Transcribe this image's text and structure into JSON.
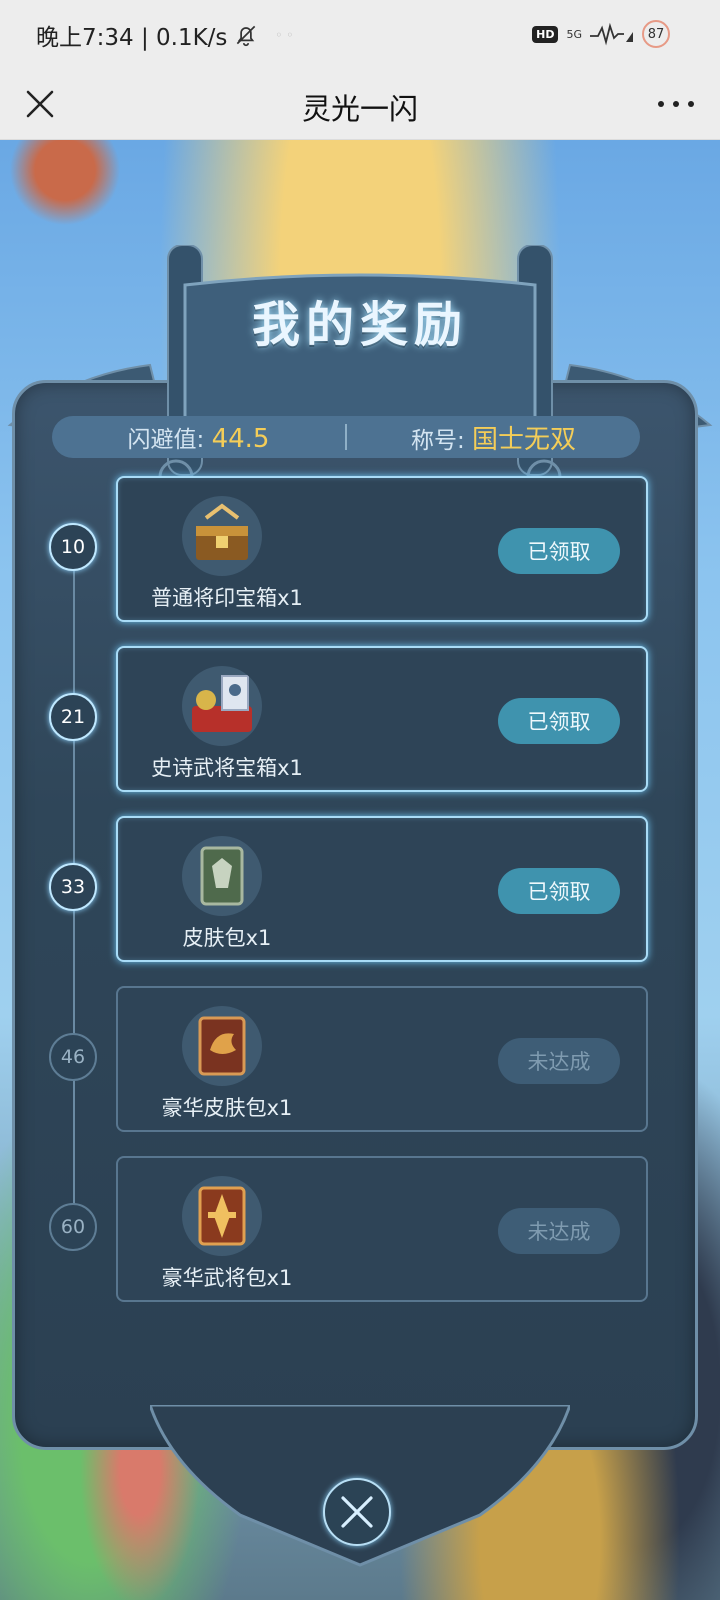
{
  "status_bar": {
    "time_speed": "晚上7:34 | 0.1K/s",
    "hd": "HD",
    "network": "5G",
    "battery": "87"
  },
  "titlebar": {
    "title": "灵光一闪"
  },
  "panel": {
    "title": "我的奖励",
    "dodge_label": "闪避值:",
    "dodge_value": "44.5",
    "rank_label": "称号:",
    "rank_value": "国士无双"
  },
  "rewards": [
    {
      "level": "10",
      "name": "普通将印宝箱x1",
      "status": "已领取",
      "claimed": true,
      "icon": "seal-chest-icon"
    },
    {
      "level": "21",
      "name": "史诗武将宝箱x1",
      "status": "已领取",
      "claimed": true,
      "icon": "general-chest-icon"
    },
    {
      "level": "33",
      "name": "皮肤包x1",
      "status": "已领取",
      "claimed": true,
      "icon": "skin-pack-icon"
    },
    {
      "level": "46",
      "name": "豪华皮肤包x1",
      "status": "未达成",
      "claimed": false,
      "icon": "deluxe-skin-pack-icon"
    },
    {
      "level": "60",
      "name": "豪华武将包x1",
      "status": "未达成",
      "claimed": false,
      "icon": "deluxe-general-pack-icon"
    }
  ],
  "colors": {
    "claimed_button": "#3f93ae",
    "pending_button": "#3e5d76",
    "stat_value": "#f4cd58",
    "panel": "#2f4659"
  }
}
